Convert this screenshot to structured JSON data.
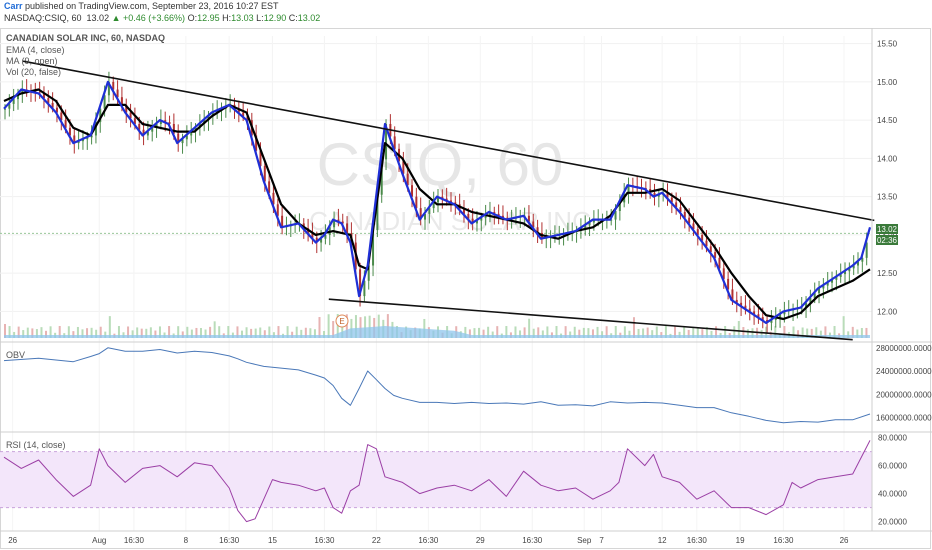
{
  "header": {
    "author": "Carr",
    "published": "published on TradingView.com, September 23, 2016 10:27 EST",
    "symbol": "NASDAQ:CSIQ, 60",
    "last": "13.02",
    "change": "▲ +0.46 (+3.66%)",
    "o_label": "O:",
    "o": "12.95",
    "h_label": "H:",
    "h": "13.03",
    "l_label": "L:",
    "l": "12.90",
    "c_label": "C:",
    "c": "13.02"
  },
  "chart_data": [
    {
      "type": "line",
      "title": "CANADIAN SOLAR INC, 60, NASDAQ",
      "watermark": "CSIQ, 60",
      "watermark_sub": "CANADIAN SOLAR INC",
      "indicators": [
        "EMA (4, close)",
        "MA (9, open)",
        "Vol (20, false)"
      ],
      "x_ticks": [
        "26",
        "Aug",
        "16:30",
        "8",
        "16:30",
        "15",
        "16:30",
        "22",
        "16:30",
        "29",
        "16:30",
        "Sep",
        "7",
        "12",
        "16:30",
        "19",
        "16:30",
        "26"
      ],
      "y_ticks": [
        "15.50",
        "15.00",
        "14.50",
        "14.00",
        "13.50",
        "13.00",
        "12.50",
        "12.00"
      ],
      "ylim": [
        11.6,
        15.6
      ],
      "price_labels": {
        "last": "13.02",
        "countdown": "02:36"
      },
      "earnings_marker": "E",
      "colors": {
        "ema": "#1f2fd6",
        "ma": "#000000",
        "up": "#4a8a4a",
        "down": "#b03030",
        "volume": "#8fc6ec"
      },
      "series": [
        {
          "name": "EMA (4, close)",
          "x": [
            0,
            2,
            4,
            6,
            8,
            10,
            12,
            14,
            16,
            18,
            19,
            20,
            22,
            24,
            26,
            28,
            30,
            32,
            34,
            36,
            37,
            38,
            39,
            40,
            41,
            42,
            44,
            46,
            48,
            50,
            52,
            54,
            56,
            58,
            60,
            62,
            64,
            66,
            68,
            70,
            72,
            74,
            75,
            76,
            78,
            80,
            82,
            84,
            86,
            88,
            90,
            92,
            94,
            96,
            98,
            99,
            100
          ],
          "values": [
            14.65,
            14.9,
            14.85,
            14.6,
            14.2,
            14.3,
            15.0,
            14.6,
            14.3,
            14.5,
            14.45,
            14.2,
            14.4,
            14.6,
            14.7,
            14.5,
            13.7,
            13.1,
            13.15,
            12.9,
            13.0,
            13.2,
            13.15,
            12.9,
            12.2,
            12.6,
            14.45,
            13.8,
            13.2,
            13.5,
            13.4,
            13.15,
            13.3,
            13.2,
            13.25,
            12.95,
            13.0,
            13.05,
            13.2,
            13.2,
            13.65,
            13.6,
            13.5,
            13.55,
            13.3,
            13.0,
            12.7,
            12.15,
            12.0,
            11.85,
            12.0,
            12.05,
            12.3,
            12.45,
            12.6,
            12.7,
            13.1
          ]
        },
        {
          "name": "MA (9, open)",
          "x": [
            0,
            2,
            4,
            6,
            8,
            10,
            12,
            14,
            16,
            18,
            20,
            22,
            24,
            26,
            28,
            30,
            32,
            34,
            36,
            38,
            40,
            41,
            42,
            44,
            46,
            48,
            50,
            52,
            54,
            56,
            58,
            60,
            62,
            64,
            66,
            68,
            70,
            72,
            74,
            76,
            78,
            80,
            82,
            84,
            86,
            88,
            90,
            92,
            94,
            96,
            98,
            100
          ],
          "values": [
            14.75,
            14.85,
            14.9,
            14.75,
            14.4,
            14.3,
            14.7,
            14.7,
            14.45,
            14.4,
            14.35,
            14.35,
            14.55,
            14.7,
            14.6,
            14.0,
            13.4,
            13.15,
            13.0,
            13.05,
            13.0,
            12.6,
            12.55,
            14.2,
            14.0,
            13.6,
            13.4,
            13.4,
            13.3,
            13.25,
            13.2,
            13.15,
            13.0,
            12.95,
            13.05,
            13.1,
            13.25,
            13.55,
            13.55,
            13.6,
            13.45,
            13.15,
            12.85,
            12.5,
            12.2,
            11.95,
            11.9,
            11.98,
            12.2,
            12.3,
            12.4,
            12.55
          ]
        }
      ],
      "trendlines": [
        {
          "name": "upper",
          "x": [
            2.2,
            100.5
          ],
          "values": [
            15.27,
            13.19
          ]
        },
        {
          "name": "lower",
          "x": [
            37.5,
            98.0
          ],
          "values": [
            12.16,
            11.63
          ]
        }
      ]
    },
    {
      "type": "line",
      "title": "OBV",
      "y_ticks": [
        "28000000.0000",
        "24000000.0000",
        "20000000.0000",
        "16000000.0000"
      ],
      "ylim": [
        13500000,
        29000000
      ],
      "series": [
        {
          "name": "OBV",
          "x": [
            0,
            4,
            8,
            10,
            11,
            12,
            14,
            16,
            18,
            20,
            22,
            24,
            26,
            27,
            28,
            30,
            32,
            34,
            36,
            37,
            38,
            39,
            40,
            41,
            42,
            43,
            44,
            45,
            46,
            48,
            50,
            52,
            54,
            56,
            58,
            60,
            62,
            64,
            66,
            68,
            70,
            72,
            74,
            76,
            78,
            80,
            82,
            84,
            86,
            88,
            90,
            92,
            94,
            96,
            98,
            100
          ],
          "values": [
            25800000,
            26200000,
            25600000,
            26500000,
            27000000,
            28000000,
            27400000,
            27400000,
            27700000,
            27100000,
            27400000,
            27200000,
            26600000,
            26100000,
            25500000,
            24800000,
            24500000,
            24200000,
            23300000,
            22800000,
            21500000,
            19300000,
            18100000,
            21000000,
            24000000,
            22500000,
            21000000,
            19800000,
            19300000,
            18600000,
            18600000,
            18400000,
            18600000,
            18400000,
            18500000,
            18300000,
            18700000,
            18100000,
            18200000,
            18000000,
            18700000,
            18500000,
            18600000,
            18500000,
            18100000,
            17700000,
            17700000,
            16800000,
            16200000,
            15500000,
            15100000,
            15300000,
            15200000,
            15600000,
            15600000,
            16600000
          ]
        }
      ]
    },
    {
      "type": "line",
      "title": "RSI (14, close)",
      "y_ticks": [
        "80.0000",
        "60.0000",
        "40.0000",
        "20.0000"
      ],
      "ylim": [
        14,
        84
      ],
      "bands": [
        30,
        70
      ],
      "series": [
        {
          "name": "RSI (14, close)",
          "x": [
            0,
            2,
            4,
            6,
            8,
            10,
            11,
            12,
            14,
            16,
            18,
            20,
            22,
            24,
            26,
            27,
            28,
            29,
            30,
            31,
            32,
            34,
            36,
            37,
            38,
            39,
            40,
            41,
            42,
            43,
            44,
            46,
            48,
            50,
            52,
            54,
            56,
            58,
            60,
            62,
            64,
            66,
            68,
            70,
            71,
            72,
            74,
            75,
            76,
            78,
            80,
            82,
            84,
            86,
            88,
            90,
            91,
            92,
            94,
            96,
            98,
            100
          ],
          "values": [
            66,
            58,
            64,
            50,
            38,
            46,
            72,
            60,
            48,
            58,
            60,
            52,
            62,
            60,
            44,
            28,
            20,
            22,
            36,
            50,
            48,
            46,
            42,
            44,
            30,
            26,
            42,
            46,
            75,
            72,
            52,
            48,
            40,
            44,
            46,
            42,
            50,
            38,
            56,
            46,
            42,
            44,
            36,
            42,
            48,
            72,
            60,
            68,
            52,
            48,
            36,
            42,
            30,
            30,
            25,
            32,
            48,
            44,
            50,
            52,
            54,
            78
          ]
        }
      ]
    }
  ]
}
